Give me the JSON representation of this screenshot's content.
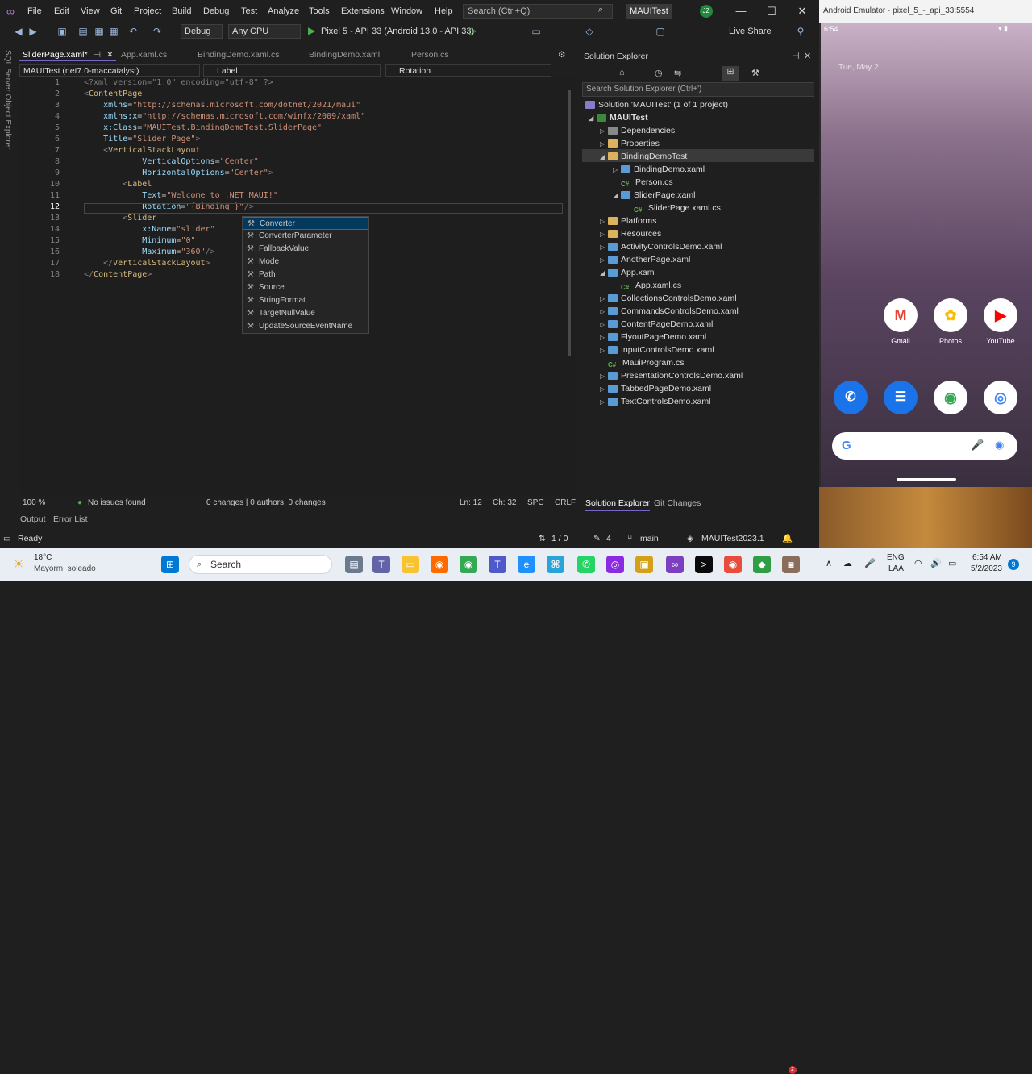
{
  "vs": {
    "menu": [
      "File",
      "Edit",
      "View",
      "Git",
      "Project",
      "Build",
      "Debug",
      "Test",
      "Analyze",
      "Tools",
      "Extensions",
      "Window",
      "Help"
    ],
    "search_placeholder": "Search (Ctrl+Q)",
    "project_title": "MAUITest",
    "avatar": "JZ",
    "toolbar": {
      "config": "Debug",
      "platform": "Any CPU",
      "run_target": "Pixel 5 - API 33 (Android 13.0 - API 33)",
      "live_share": "Live Share"
    },
    "side_strip": "SQL Server Object Explorer",
    "tabs": [
      "SliderPage.xaml*",
      "App.xaml.cs",
      "BindingDemo.xaml.cs",
      "BindingDemo.xaml",
      "Person.cs"
    ],
    "navbar": {
      "scope": "MAUITest (net7.0-maccatalyst)",
      "element": "Label",
      "member": "Rotation"
    },
    "editor_status": {
      "zoom": "100 %",
      "issues": "No issues found",
      "changes": "0 changes | 0 authors, 0 changes",
      "ln": "Ln: 12",
      "ch": "Ch: 32",
      "spc": "SPC",
      "crlf": "CRLF"
    },
    "bottom_tabs": [
      "Output",
      "Error List"
    ],
    "intellisense": [
      "Converter",
      "ConverterParameter",
      "FallbackValue",
      "Mode",
      "Path",
      "Source",
      "StringFormat",
      "TargetNullValue",
      "UpdateSourceEventName"
    ],
    "status": {
      "ready": "Ready",
      "arrows": "1 / 0",
      "pencil": "4",
      "branch": "main",
      "repo": "MAUITest2023.1",
      "notif": "2"
    }
  },
  "solution_explorer": {
    "title": "Solution Explorer",
    "search_placeholder": "Search Solution Explorer (Ctrl+')",
    "items": [
      "Solution 'MAUITest' (1 of 1 project)",
      "MAUITest",
      "Dependencies",
      "Properties",
      "BindingDemoTest",
      "BindingDemo.xaml",
      "Person.cs",
      "SliderPage.xaml",
      "SliderPage.xaml.cs",
      "Platforms",
      "Resources",
      "ActivityControlsDemo.xaml",
      "AnotherPage.xaml",
      "App.xaml",
      "App.xaml.cs",
      "CollectionsControlsDemo.xaml",
      "CommandsControlsDemo.xaml",
      "ContentPageDemo.xaml",
      "FlyoutPageDemo.xaml",
      "InputControlsDemo.xaml",
      "MauiProgram.cs",
      "PresentationControlsDemo.xaml",
      "TabbedPageDemo.xaml",
      "TextControlsDemo.xaml"
    ],
    "tabs": [
      "Solution Explorer",
      "Git Changes"
    ]
  },
  "emulator": {
    "title": "Android Emulator - pixel_5_-_api_33:5554",
    "time": "6:54",
    "date": "Tue, May 2",
    "apps": [
      "Gmail",
      "Photos",
      "YouTube"
    ]
  },
  "taskbar": {
    "temp": "18°C",
    "weather": "Mayorm. soleado",
    "search": "Search",
    "lang": "ENG",
    "region": "LAA",
    "time": "6:54 AM",
    "date": "5/2/2023",
    "badge": "9"
  }
}
